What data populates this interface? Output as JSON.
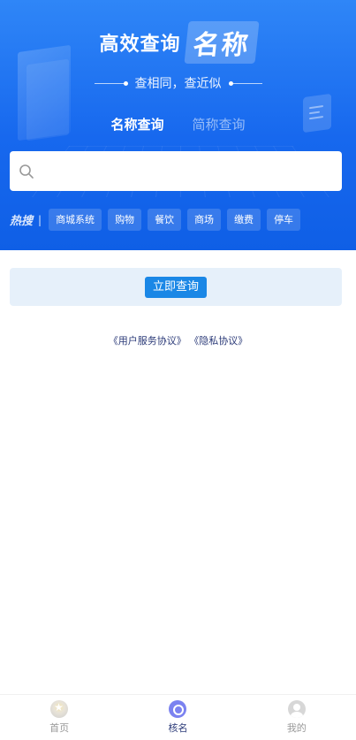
{
  "hero": {
    "title": "高效查询",
    "title_highlight": "名称",
    "subtitle": "查相同，查近似"
  },
  "tabs": [
    {
      "label": "名称查询",
      "active": true
    },
    {
      "label": "简称查询",
      "active": false
    }
  ],
  "search": {
    "value": "",
    "placeholder": ""
  },
  "hot_search": {
    "label": "热搜",
    "separator": "|",
    "tags": [
      "商城系统",
      "购物",
      "餐饮",
      "商场",
      "缴费",
      "停车"
    ]
  },
  "query_button": "立即查询",
  "agreement": {
    "user_agreement": "《用户服务协议》",
    "privacy_agreement": "《隐私协议》"
  },
  "tabbar": {
    "items": [
      {
        "label": "首页",
        "icon": "home-icon",
        "active": false,
        "color": "#999999"
      },
      {
        "label": "核名",
        "icon": "name-check-icon",
        "active": true,
        "color": "#2b3a78"
      },
      {
        "label": "我的",
        "icon": "profile-icon",
        "active": false,
        "color": "#999999"
      }
    ]
  },
  "colors": {
    "hero_blue": "#1768ee",
    "accent": "#1a87e6",
    "panel_bg": "#e6f0fa"
  }
}
